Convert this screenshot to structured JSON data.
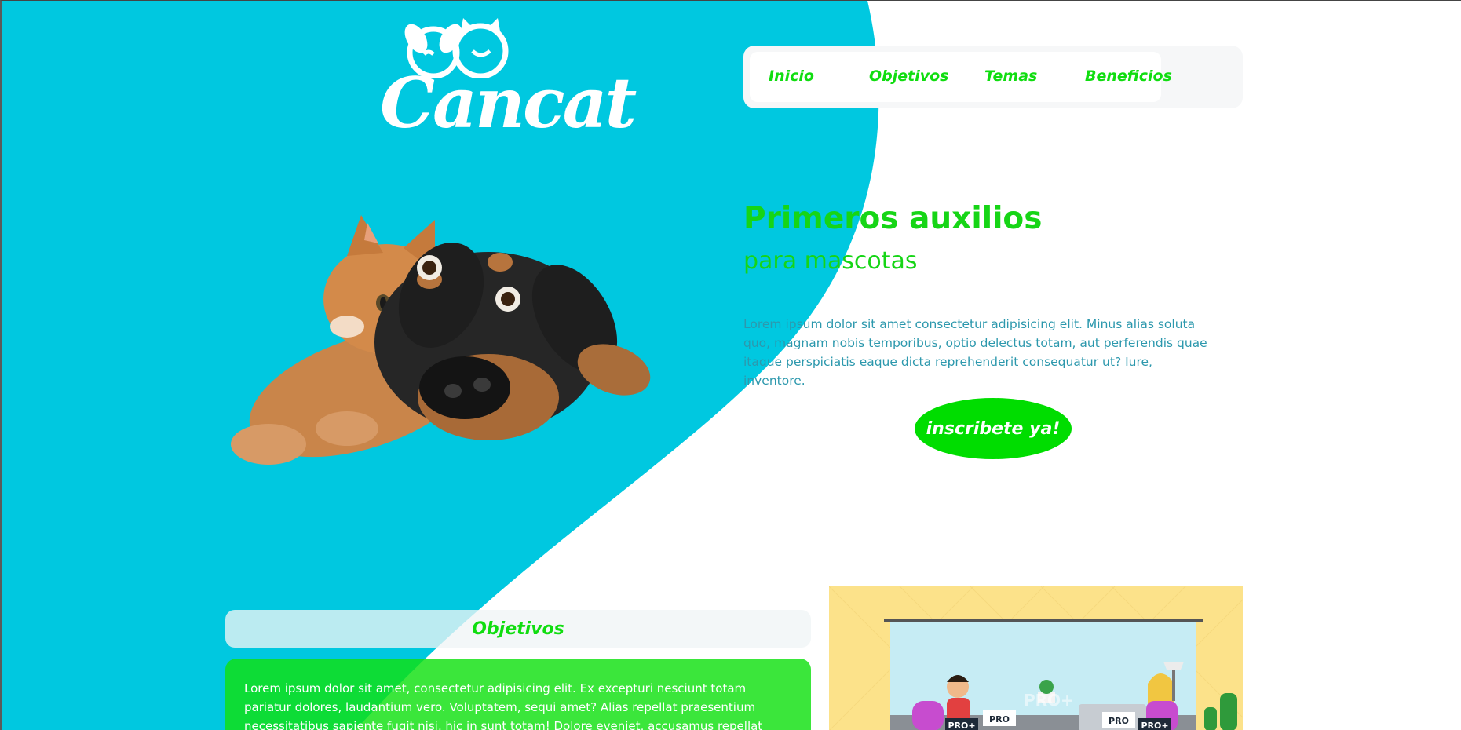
{
  "brand": {
    "name": "Cancat"
  },
  "nav": {
    "items": [
      {
        "label": "Inicio"
      },
      {
        "label": "Objetivos"
      },
      {
        "label": "Temas"
      },
      {
        "label": "Beneficios"
      }
    ]
  },
  "hero": {
    "title": "Primeros auxilios",
    "subtitle": "para mascotas",
    "paragraph": "Lorem ipsum dolor sit amet consectetur adipisicing elit. Minus alias soluta quo, magnam nobis temporibus, optio delectus totam, aut perferendis quae itaque perspiciatis eaque dicta reprehenderit consequatur ut? Iure, inventore.",
    "cta_label": "inscribete ya!"
  },
  "objetivos": {
    "title": "Objetivos",
    "text": "Lorem ipsum dolor sit amet, consectetur adipisicing elit. Ex excepturi nesciunt totam pariatur dolores, laudantium vero. Voluptatem, sequi amet? Alias repellat praesentium necessitatibus sapiente fugit nisi, hic in sunt totam! Dolore eveniet, accusamus repellat suscipit, officia sed tenetur"
  },
  "illustration": {
    "badges": [
      "PRO+",
      "PRO",
      "PRO",
      "PRO+"
    ],
    "watermark": "PRO+"
  },
  "colors": {
    "cyan": "#00c8e0",
    "green": "#10dd10",
    "paragraph_text": "#2c98ad",
    "illustration_bg": "#fce28a"
  }
}
